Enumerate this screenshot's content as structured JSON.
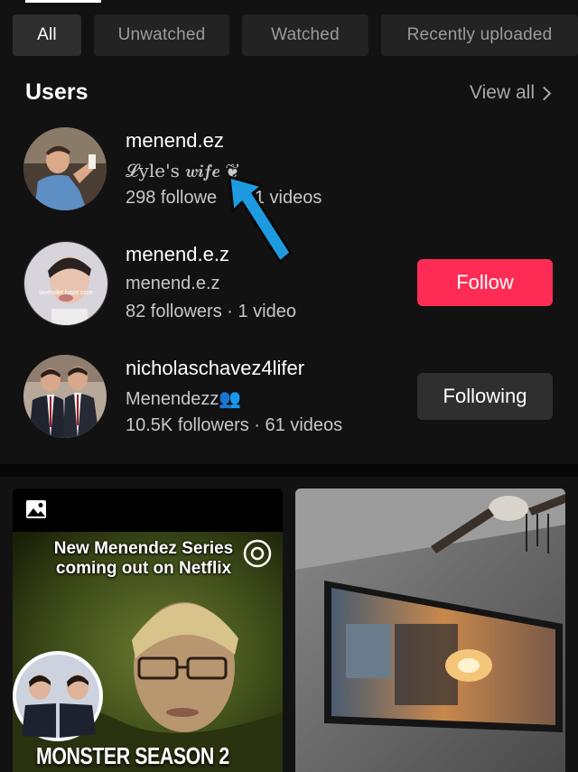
{
  "filters": {
    "tabs": [
      {
        "label": "All",
        "active": true
      },
      {
        "label": "Unwatched",
        "active": false
      },
      {
        "label": "Watched",
        "active": false
      },
      {
        "label": "Recently uploaded",
        "active": false
      }
    ]
  },
  "users_section": {
    "title": "Users",
    "view_all": "View all"
  },
  "users": [
    {
      "name": "menend.ez",
      "subtitle": "𝓛yle's 𝒘𝒊𝒇𝒆 ❦",
      "stats": "298 followe",
      "stats_tail": "11 videos",
      "button": ""
    },
    {
      "name": "menend.e.z",
      "subtitle": "menend.e.z",
      "stats": "82 followers · 1 video",
      "button": "Follow",
      "avatar_caption": "lavender haze core"
    },
    {
      "name": "nicholaschavez4lifer",
      "subtitle": "Menendezz👥",
      "stats": "10.5K followers · 61 videos",
      "button": "Following"
    }
  ],
  "videos": [
    {
      "headline": "New Menendez Series coming out on Netflix",
      "footer": "MONSTER SEASON 2",
      "badge": "C"
    },
    {
      "headline": "",
      "footer": ""
    }
  ],
  "colors": {
    "background": "#121212",
    "follow_button": "#fe2c55",
    "following_button": "#2f2f2f",
    "annotation_arrow": "#1e9be0"
  }
}
